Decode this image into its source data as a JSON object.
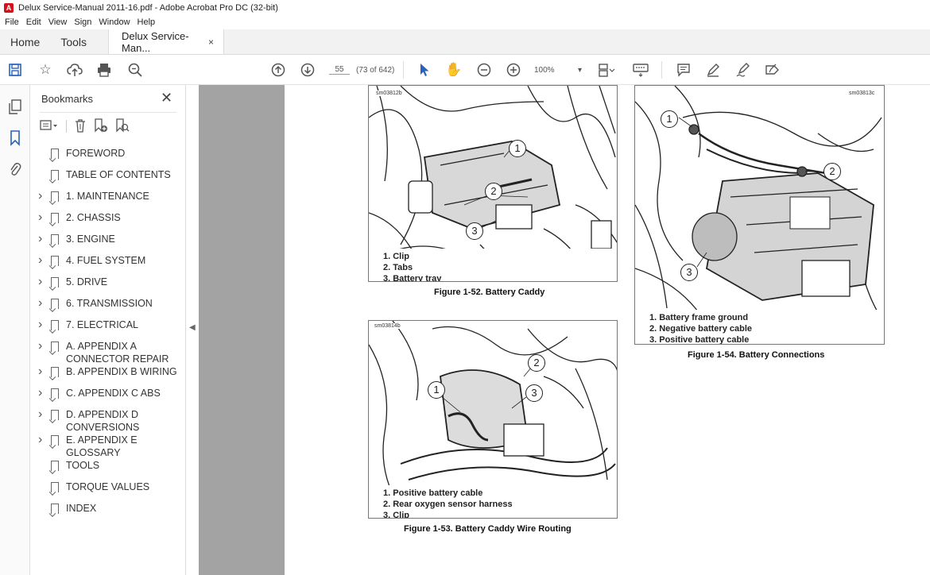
{
  "window": {
    "title": "Delux Service-Manual 2011-16.pdf - Adobe Acrobat Pro DC (32-bit)"
  },
  "menu": [
    "File",
    "Edit",
    "View",
    "Sign",
    "Window",
    "Help"
  ],
  "tabs": {
    "home": "Home",
    "tools": "Tools",
    "document": "Delux Service-Man...",
    "close": "×"
  },
  "toolbar": {
    "page_number": "55",
    "page_info": "(73 of 642)",
    "zoom": "100%",
    "zoom_caret": "▾"
  },
  "bookmarks": {
    "title": "Bookmarks",
    "close": "✕",
    "items": [
      {
        "label": "FOREWORD",
        "expandable": false
      },
      {
        "label": "TABLE OF CONTENTS",
        "expandable": false
      },
      {
        "label": "1. MAINTENANCE",
        "expandable": true
      },
      {
        "label": "2. CHASSIS",
        "expandable": true
      },
      {
        "label": "3. ENGINE",
        "expandable": true
      },
      {
        "label": "4. FUEL SYSTEM",
        "expandable": true
      },
      {
        "label": "5. DRIVE",
        "expandable": true
      },
      {
        "label": "6. TRANSMISSION",
        "expandable": true
      },
      {
        "label": "7. ELECTRICAL",
        "expandable": true
      },
      {
        "label": "A. APPENDIX A CONNECTOR REPAIR",
        "expandable": true
      },
      {
        "label": "B. APPENDIX B WIRING",
        "expandable": true
      },
      {
        "label": "C. APPENDIX C ABS",
        "expandable": true
      },
      {
        "label": "D. APPENDIX D CONVERSIONS",
        "expandable": true
      },
      {
        "label": "E. APPENDIX E GLOSSARY",
        "expandable": true
      },
      {
        "label": "TOOLS",
        "expandable": false
      },
      {
        "label": "TORQUE VALUES",
        "expandable": false
      },
      {
        "label": "INDEX",
        "expandable": false
      }
    ]
  },
  "figures": {
    "fig52": {
      "id": "sm03812b",
      "legend": [
        "1.  Clip",
        "2.  Tabs",
        "3.  Battery tray"
      ],
      "caption": "Figure 1-52. Battery Caddy",
      "callouts": [
        "1",
        "2",
        "3"
      ]
    },
    "fig53": {
      "id": "sm03814b",
      "legend": [
        "1.  Positive battery cable",
        "2.  Rear oxygen sensor harness",
        "3.  Clip"
      ],
      "caption": "Figure 1-53. Battery Caddy Wire Routing",
      "callouts": [
        "1",
        "2",
        "3"
      ]
    },
    "fig54": {
      "id": "sm03813c",
      "legend": [
        "1.  Battery frame ground",
        "2.  Negative battery cable",
        "3.  Positive battery cable"
      ],
      "caption": "Figure 1-54. Battery Connections",
      "callouts": [
        "1",
        "2",
        "3"
      ]
    }
  }
}
